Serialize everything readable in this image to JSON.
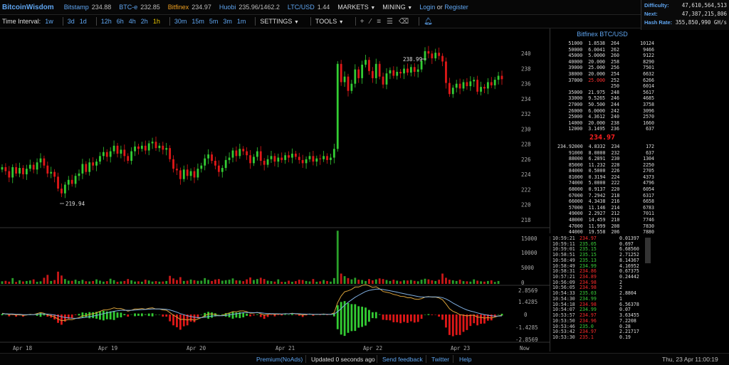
{
  "topbar": {
    "logo": "BitcoinWisdom",
    "exchanges": [
      {
        "name": "Bitstamp",
        "price": "234.88",
        "active": false
      },
      {
        "name": "BTC-e",
        "price": "232.85",
        "active": false
      },
      {
        "name": "Bitfinex",
        "price": "234.97",
        "active": true
      },
      {
        "name": "Huobi",
        "price": "235.96/1462.2",
        "active": false
      },
      {
        "name": "LTC/USD",
        "price": "1.44",
        "active": false
      }
    ],
    "markets_label": "MARKETS",
    "mining_label": "MINING",
    "login_label": "Login",
    "or_label": "or",
    "register_label": "Register"
  },
  "network": {
    "difficulty_label": "Difficulty:",
    "difficulty_value": "47,610,564,513",
    "next_label": "Next:",
    "next_value": "47,387,215,806",
    "hashrate_label": "Hash Rate:",
    "hashrate_value": "355,850,990 GH/s"
  },
  "toolbar": {
    "time_interval_label": "Time Interval:",
    "intervals": [
      "1w",
      "3d",
      "1d",
      "12h",
      "6h",
      "4h",
      "2h",
      "1h",
      "30m",
      "15m",
      "5m",
      "3m",
      "1m"
    ],
    "active_interval": "1h",
    "settings_label": "SETTINGS",
    "tools_label": "TOOLS"
  },
  "chart": {
    "price_axis": [
      "240",
      "238",
      "236",
      "234",
      "232",
      "230",
      "228",
      "226",
      "224",
      "222",
      "220",
      "218"
    ],
    "volume_axis": [
      "15000",
      "10000",
      "5000",
      "0"
    ],
    "macd_axis": [
      "2.8569",
      "1.4285",
      "0",
      "-1.4285",
      "-2.8569"
    ],
    "x_axis": [
      "Apr 18",
      "Apr 19",
      "Apr 20",
      "Apr 21",
      "Apr 22",
      "Apr 23",
      "Now"
    ],
    "high_label": "238.99",
    "low_label": "219.94",
    "colors": {
      "up": "#33cc33",
      "down": "#e01818",
      "macd": "#d8a13a",
      "signal": "#7faee0"
    }
  },
  "chart_data": {
    "type": "candlestick",
    "pair": "BTC/USD",
    "x_ticks": [
      "Apr 18",
      "Apr 19",
      "Apr 20",
      "Apr 21",
      "Apr 22",
      "Apr 23",
      "Now"
    ],
    "ylim_price": [
      217,
      241
    ],
    "ylim_volume": [
      0,
      17000
    ],
    "ylim_macd": [
      -2.8569,
      2.8569
    ],
    "price_high_marker": 238.99,
    "price_low_marker": 219.94,
    "close": [
      223.9,
      223.4,
      222.6,
      223.9,
      223.1,
      223.8,
      223.0,
      223.7,
      224.2,
      223.6,
      224.5,
      225.0,
      224.1,
      223.1,
      223.3,
      222.7,
      221.2,
      220.6,
      221.7,
      222.3,
      221.8,
      222.8,
      223.1,
      224.3,
      223.3,
      224.5,
      224.1,
      224.6,
      225.3,
      225.8,
      225.2,
      225.9,
      226.6,
      225.6,
      226.1,
      225.3,
      224.7,
      225.9,
      226.5,
      226.2,
      226.6,
      226.0,
      226.9,
      227.1,
      226.3,
      226.6,
      226.1,
      226.3,
      224.9,
      223.7,
      223.5,
      222.4,
      223.6,
      222.8,
      223.4,
      222.6,
      223.7,
      224.1,
      225.0,
      225.5,
      224.7,
      224.1,
      223.3,
      223.8,
      224.8,
      225.1,
      226.0,
      225.3,
      226.2,
      225.9,
      225.4,
      224.4,
      225.2,
      225.9,
      224.7,
      224.2,
      224.9,
      225.3,
      224.6,
      225.1,
      224.8,
      225.4,
      225.1,
      225.6,
      225.2,
      224.8,
      224.4,
      224.9,
      225.3,
      224.6,
      225.0,
      224.9,
      225.3,
      224.8,
      225.1,
      226.2,
      236.9,
      234.6,
      235.3,
      233.5,
      234.4,
      236.2,
      235.1,
      236.8,
      237.4,
      236.0,
      235.1,
      236.9,
      235.3,
      234.3,
      235.7,
      236.1,
      235.4,
      235.9,
      235.7,
      236.3,
      235.8,
      236.5,
      235.9,
      236.2,
      237.3,
      238.5,
      238.2,
      237.6,
      238.3,
      237.9,
      237.2,
      234.5,
      233.1,
      233.9,
      234.4,
      233.8,
      234.6,
      234.1,
      234.7,
      234.9,
      233.4,
      234.0,
      233.8,
      234.6,
      234.2,
      234.9,
      235.4,
      234.97
    ],
    "volume": [
      800,
      950,
      700,
      1800,
      600,
      1100,
      750,
      900,
      1050,
      1400,
      650,
      800,
      1900,
      2800,
      900,
      1200,
      3800,
      2600,
      1500,
      1000,
      950,
      1300,
      880,
      1250,
      820,
      760,
      900,
      1400,
      1000,
      700,
      850,
      1600,
      1150,
      650,
      780,
      900,
      1500,
      1100,
      720,
      800,
      680,
      1300,
      1050,
      720,
      850,
      690,
      740,
      900,
      2500,
      1700,
      1200,
      2100,
      900,
      1000,
      1350,
      1150,
      950,
      1000,
      1800,
      1250,
      900,
      1350,
      1500,
      1000,
      1150,
      1300,
      1700,
      1100,
      1050,
      850,
      1400,
      2000,
      1200,
      1500,
      1900,
      1500,
      1000,
      850,
      700,
      1400,
      650,
      600,
      1000,
      650,
      850,
      1300,
      1200,
      900,
      750,
      1500,
      650,
      800,
      1200,
      900,
      700,
      1800,
      16500,
      3200,
      2400,
      1800,
      1400,
      1900,
      1300,
      1200,
      900,
      1500,
      1100,
      1400,
      1700,
      1500,
      1200,
      900,
      1300,
      1000,
      800,
      1100,
      1050,
      1200,
      950,
      800,
      1300,
      1600,
      1400,
      1100,
      900,
      1300,
      3200,
      1900,
      1300,
      1100,
      900,
      1300,
      850,
      800,
      700,
      1400,
      1000,
      800,
      700,
      900,
      1100,
      600,
      900
    ],
    "macd": [
      0.1,
      0.06,
      -0.02,
      0.02,
      -0.05,
      -0.02,
      -0.08,
      -0.04,
      0.02,
      -0.01,
      0.08,
      0.16,
      0.1,
      -0.04,
      -0.1,
      -0.2,
      -0.38,
      -0.52,
      -0.48,
      -0.42,
      -0.44,
      -0.34,
      -0.26,
      -0.1,
      -0.1,
      0.02,
      0.06,
      0.14,
      0.26,
      0.38,
      0.38,
      0.46,
      0.56,
      0.48,
      0.5,
      0.4,
      0.28,
      0.36,
      0.46,
      0.46,
      0.5,
      0.44,
      0.52,
      0.56,
      0.46,
      0.46,
      0.38,
      0.36,
      0.16,
      -0.06,
      -0.22,
      -0.42,
      -0.4,
      -0.46,
      -0.4,
      -0.48,
      -0.38,
      -0.26,
      -0.1,
      0.04,
      0.04,
      0.0,
      -0.1,
      -0.08,
      0.04,
      0.12,
      0.24,
      0.22,
      0.3,
      0.3,
      0.24,
      0.1,
      0.12,
      0.18,
      0.06,
      -0.04,
      0.0,
      0.06,
      0.0,
      0.04,
      0.02,
      0.08,
      0.06,
      0.1,
      0.06,
      0.02,
      -0.04,
      0.0,
      0.04,
      -0.02,
      0.02,
      0.0,
      0.04,
      0.0,
      0.02,
      0.14,
      1.0,
      1.55,
      1.9,
      1.98,
      2.1,
      2.3,
      2.3,
      2.42,
      2.5,
      2.4,
      2.26,
      2.32,
      2.15,
      1.92,
      1.86,
      1.8,
      1.68,
      1.62,
      1.52,
      1.5,
      1.4,
      1.4,
      1.3,
      1.26,
      1.32,
      1.46,
      1.5,
      1.45,
      1.46,
      1.38,
      1.24,
      0.88,
      0.48,
      0.26,
      0.14,
      -0.02,
      -0.06,
      -0.12,
      -0.08,
      -0.06,
      -0.22,
      -0.24,
      -0.3,
      -0.26,
      -0.3,
      -0.22,
      -0.12,
      -0.06
    ],
    "signal": [
      0.06,
      0.06,
      0.04,
      0.04,
      0.02,
      0.01,
      -0.01,
      -0.02,
      -0.01,
      -0.01,
      0.01,
      0.04,
      0.05,
      0.03,
      0.0,
      -0.04,
      -0.11,
      -0.19,
      -0.25,
      -0.28,
      -0.31,
      -0.32,
      -0.31,
      -0.27,
      -0.23,
      -0.18,
      -0.13,
      -0.08,
      -0.01,
      0.07,
      0.13,
      0.2,
      0.27,
      0.31,
      0.35,
      0.36,
      0.35,
      0.35,
      0.37,
      0.39,
      0.41,
      0.42,
      0.44,
      0.46,
      0.46,
      0.46,
      0.45,
      0.43,
      0.38,
      0.29,
      0.19,
      0.07,
      -0.02,
      -0.11,
      -0.17,
      -0.23,
      -0.26,
      -0.26,
      -0.23,
      -0.18,
      -0.13,
      -0.1,
      -0.1,
      -0.1,
      -0.07,
      -0.03,
      0.02,
      0.06,
      0.11,
      0.15,
      0.17,
      0.16,
      0.15,
      0.16,
      0.14,
      0.1,
      0.08,
      0.08,
      0.06,
      0.06,
      0.05,
      0.06,
      0.06,
      0.07,
      0.07,
      0.06,
      0.04,
      0.03,
      0.03,
      0.02,
      0.02,
      0.02,
      0.02,
      0.02,
      0.02,
      0.04,
      0.23,
      0.5,
      0.78,
      1.02,
      1.23,
      1.44,
      1.61,
      1.77,
      1.92,
      2.02,
      2.07,
      2.12,
      2.13,
      2.09,
      2.04,
      1.99,
      1.93,
      1.87,
      1.8,
      1.74,
      1.67,
      1.62,
      1.56,
      1.5,
      1.46,
      1.46,
      1.47,
      1.47,
      1.47,
      1.45,
      1.41,
      1.3,
      1.14,
      0.96,
      0.8,
      0.64,
      0.5,
      0.38,
      0.29,
      0.22,
      0.13,
      0.06,
      -0.01,
      -0.06,
      -0.11,
      -0.13,
      -0.13,
      -0.12
    ]
  },
  "orderbook": {
    "title": "Bitfinex BTC/USD",
    "asks": [
      [
        "51000",
        "1.8538",
        "264",
        "10124"
      ],
      [
        "50000",
        "6.0041",
        "262",
        "9466"
      ],
      [
        "45000",
        "5.0000",
        "260",
        "9122"
      ],
      [
        "40000",
        "20.000",
        "258",
        "8290"
      ],
      [
        "39000",
        "25.000",
        "256",
        "7501"
      ],
      [
        "38000",
        "20.000",
        "254",
        "6632"
      ],
      [
        "37000",
        "25.000",
        "252",
        "6266"
      ],
      [
        "",
        "",
        "250",
        "6014"
      ],
      [
        "35000",
        "21.975",
        "248",
        "5617"
      ],
      [
        "33000",
        "9.5265",
        "246",
        "4685"
      ],
      [
        "27000",
        "50.500",
        "244",
        "3758"
      ],
      [
        "26000",
        "6.0000",
        "242",
        "3096"
      ],
      [
        "25000",
        "4.3612",
        "240",
        "2570"
      ],
      [
        "14000",
        "20.000",
        "238",
        "1660"
      ],
      [
        "12000",
        "3.1495",
        "236",
        "637"
      ]
    ],
    "last_price": "234.97",
    "bids": [
      [
        "234.92000",
        "4.8332",
        "234",
        "172"
      ],
      [
        "91000",
        "8.0000",
        "232",
        "637"
      ],
      [
        "88000",
        "6.2891",
        "230",
        "1304"
      ],
      [
        "85000",
        "11.232",
        "228",
        "2250"
      ],
      [
        "84000",
        "0.5000",
        "226",
        "2705"
      ],
      [
        "81000",
        "0.3194",
        "224",
        "4373"
      ],
      [
        "74000",
        "5.0000",
        "222",
        "4796"
      ],
      [
        "68000",
        "0.9137",
        "220",
        "6054"
      ],
      [
        "67000",
        "7.2942",
        "218",
        "6317"
      ],
      [
        "66000",
        "4.3438",
        "216",
        "6658"
      ],
      [
        "57000",
        "11.146",
        "214",
        "6783"
      ],
      [
        "49000",
        "2.2927",
        "212",
        "7011"
      ],
      [
        "48000",
        "14.459",
        "210",
        "7746"
      ],
      [
        "47000",
        "11.999",
        "208",
        "7830"
      ],
      [
        "44000",
        "19.558",
        "206",
        "7880"
      ]
    ]
  },
  "trades": [
    [
      "10:59:21",
      "234.97",
      "0.01397",
      "dn"
    ],
    [
      "10:59:11",
      "235.05",
      "0.697",
      "up"
    ],
    [
      "10:59:01",
      "235.15",
      "6.68560",
      "up"
    ],
    [
      "10:58:51",
      "235.15",
      "2.71252",
      "up"
    ],
    [
      "10:58:49",
      "235.13",
      "8.14367",
      "up"
    ],
    [
      "10:58:49",
      "234.99",
      "4.16952",
      "up"
    ],
    [
      "10:58:31",
      "234.86",
      "0.67375",
      "dn"
    ],
    [
      "10:57:21",
      "234.89",
      "0.24442",
      "dn"
    ],
    [
      "10:56:09",
      "234.98",
      "2",
      "dn"
    ],
    [
      "10:56:05",
      "234.98",
      "2",
      "dn"
    ],
    [
      "10:54:33",
      "235.03",
      "2.8804",
      "up"
    ],
    [
      "10:54:30",
      "234.99",
      "1",
      "up"
    ],
    [
      "10:54:18",
      "234.98",
      "6.56378",
      "dn"
    ],
    [
      "10:54:07",
      "234.99",
      "0.07",
      "up"
    ],
    [
      "10:53:57",
      "234.97",
      "3.63455",
      "dn"
    ],
    [
      "10:53:50",
      "234.96",
      "7.2208",
      "dn"
    ],
    [
      "10:53:46",
      "235.0",
      "0.28",
      "up"
    ],
    [
      "10:53:42",
      "234.97",
      "2.21717",
      "dn"
    ],
    [
      "10:53:30",
      "235.1",
      "0.19",
      "dn"
    ]
  ],
  "footer": {
    "premium": "Premium(NoAds)",
    "updated": "Updated 0 seconds ago",
    "feedback": "Send feedback",
    "twitter": "Twitter",
    "help": "Help",
    "datetime": "Thu, 23 Apr 11:00:19"
  }
}
